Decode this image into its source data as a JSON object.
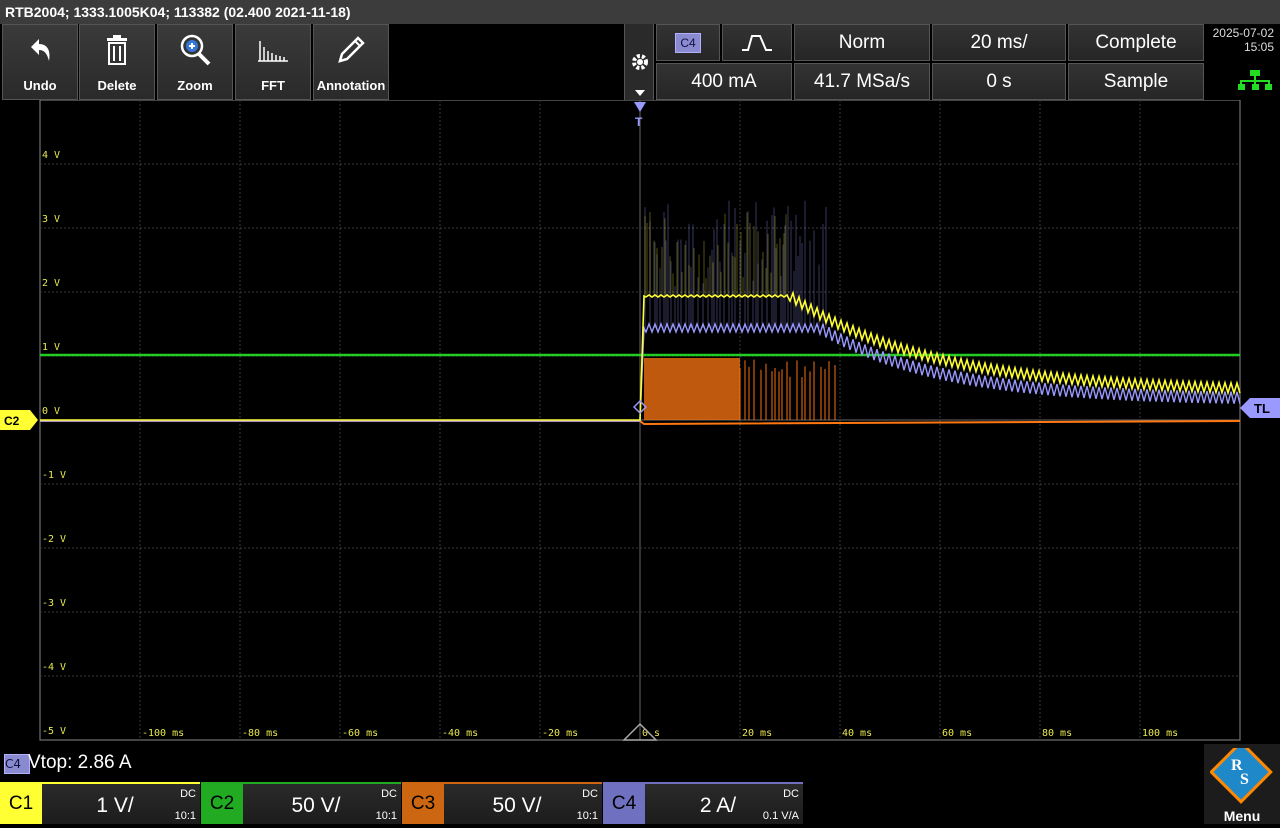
{
  "title": "RTB2004; 1333.1005K04; 113382 (02.400 2021-11-18)",
  "toolbar": [
    {
      "name": "undo-button",
      "icon": "undo-icon",
      "label": "Undo"
    },
    {
      "name": "delete-button",
      "icon": "trash-icon",
      "label": "Delete"
    },
    {
      "name": "zoom-button",
      "icon": "zoom-icon",
      "label": "Zoom"
    },
    {
      "name": "fft-button",
      "icon": "fft-icon",
      "label": "FFT"
    },
    {
      "name": "annotation-button",
      "icon": "pencil-icon",
      "label": "Annotation"
    }
  ],
  "trigger": {
    "source": "C4",
    "slope_icon": "rising-falling-edge-icon",
    "mode": "Norm",
    "level": "400 mA",
    "timebase": "20 ms/",
    "sample_rate": "41.7 MSa/s",
    "position": "0 s",
    "acquisition": "Complete",
    "acq_mode": "Sample"
  },
  "datetime": {
    "date": "2025-07-02",
    "time": "15:05"
  },
  "plot": {
    "y_labels": [
      "4 V",
      "3 V",
      "2 V",
      "1 V",
      "0 V",
      "-1 V",
      "-2 V",
      "-3 V",
      "-4 V",
      "-5 V"
    ],
    "x_labels": [
      "-100 ms",
      "-80 ms",
      "-60 ms",
      "-40 ms",
      "-20 ms",
      "0 s",
      "20 ms",
      "40 ms",
      "60 ms",
      "80 ms",
      "100 ms"
    ],
    "left_marker": "C2",
    "right_marker": "TL",
    "trigger_marker": "T",
    "colors": {
      "c1": "#ffff33",
      "c2": "#22cc22",
      "c3": "#ff7711",
      "c4": "#9999ff",
      "grid": "#3a3a3a",
      "label": "#e8e850"
    }
  },
  "status": {
    "badge": "C4",
    "text": "Vtop: 2.86 A"
  },
  "channels": [
    {
      "tag": "C1",
      "scale": "1 V/",
      "coupling": "DC",
      "ratio": "10:1",
      "color": "#ffff33",
      "text": "#000"
    },
    {
      "tag": "C2",
      "scale": "50 V/",
      "coupling": "DC",
      "ratio": "10:1",
      "color": "#22aa22",
      "text": "#000"
    },
    {
      "tag": "C3",
      "scale": "50 V/",
      "coupling": "DC",
      "ratio": "10:1",
      "color": "#cc6611",
      "text": "#000"
    },
    {
      "tag": "C4",
      "scale": "2 A/",
      "coupling": "DC",
      "ratio": "0.1 V/A",
      "color": "#7070c0",
      "text": "#000"
    }
  ],
  "menu": {
    "label": "Menu",
    "logo": "rs-logo-icon"
  }
}
